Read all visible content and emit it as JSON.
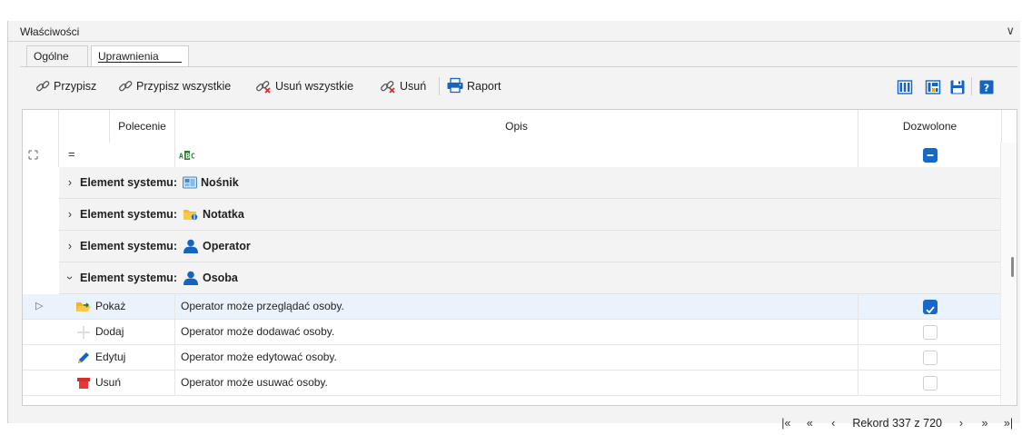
{
  "panel": {
    "title": "Właściwości"
  },
  "tabs": [
    {
      "label": "Ogólne",
      "active": false
    },
    {
      "label": "Uprawnienia",
      "active": true
    }
  ],
  "toolbar": {
    "assign_label": "Przypisz",
    "assign_all_label": "Przypisz wszystkie",
    "remove_all_label": "Usuń wszystkie",
    "remove_label": "Usuń",
    "report_label": "Raport"
  },
  "grid": {
    "columns": {
      "command": "Polecenie",
      "description": "Opis",
      "allowed": "Dozwolone"
    },
    "filter": {
      "command_operator": "=",
      "description_icon": "text-filter-icon"
    },
    "groups": [
      {
        "prefix": "Element systemu:",
        "name": "Nośnik",
        "expanded": false,
        "icon": "media-icon"
      },
      {
        "prefix": "Element systemu:",
        "name": "Notatka",
        "expanded": false,
        "icon": "note-icon"
      },
      {
        "prefix": "Element systemu:",
        "name": "Operator",
        "expanded": false,
        "icon": "operator-icon"
      },
      {
        "prefix": "Element systemu:",
        "name": "Osoba",
        "expanded": true,
        "icon": "person-icon"
      }
    ],
    "rows": [
      {
        "command": "Pokaż",
        "description": "Operator może przeglądać osoby.",
        "allowed": true,
        "icon": "show-folder-icon",
        "selected": true
      },
      {
        "command": "Dodaj",
        "description": "Operator może dodawać osoby.",
        "allowed": false,
        "icon": "plus-icon",
        "selected": false
      },
      {
        "command": "Edytuj",
        "description": "Operator może edytować osoby.",
        "allowed": false,
        "icon": "pencil-icon",
        "selected": false
      },
      {
        "command": "Usuń",
        "description": "Operator może usuwać osoby.",
        "allowed": false,
        "icon": "delete-icon",
        "selected": false
      }
    ]
  },
  "pager": {
    "status": "Rekord 337 z 720"
  },
  "colors": {
    "accent": "#1668c9",
    "selection": "#eaf2fb",
    "report_icon": "#1565c0"
  }
}
